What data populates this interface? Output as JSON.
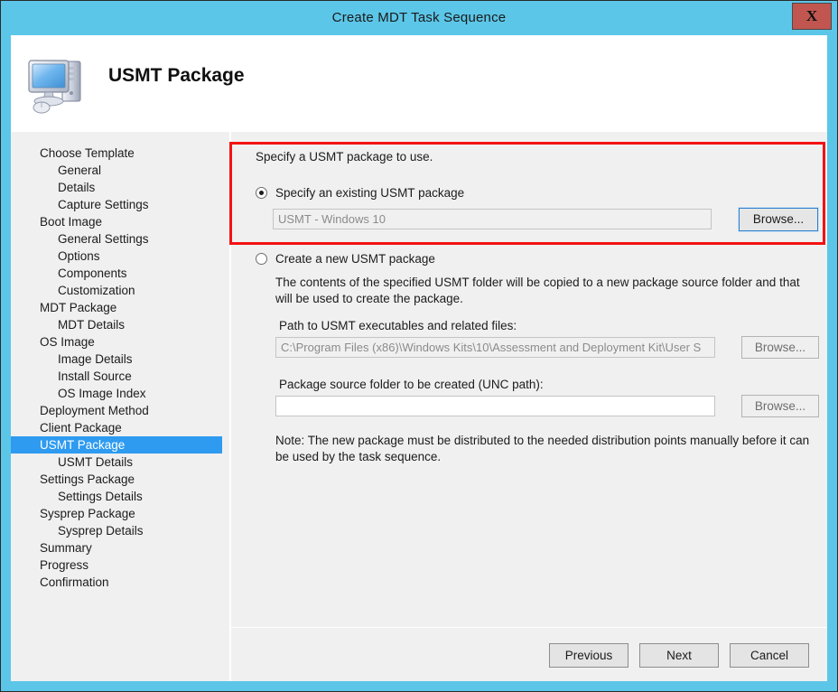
{
  "window": {
    "title": "Create MDT Task Sequence",
    "close_label": "X",
    "border_color": "#5cc6e8",
    "titlebar_color": "#5cc6e8",
    "close_button_color": "#c0564f"
  },
  "header": {
    "page_title": "USMT Package",
    "icon": "computer-monitor-icon"
  },
  "sidebar": {
    "items": [
      {
        "label": "Choose Template",
        "level": 1,
        "selected": false
      },
      {
        "label": "General",
        "level": 2,
        "selected": false
      },
      {
        "label": "Details",
        "level": 2,
        "selected": false
      },
      {
        "label": "Capture Settings",
        "level": 2,
        "selected": false
      },
      {
        "label": "Boot Image",
        "level": 1,
        "selected": false
      },
      {
        "label": "General Settings",
        "level": 2,
        "selected": false
      },
      {
        "label": "Options",
        "level": 2,
        "selected": false
      },
      {
        "label": "Components",
        "level": 2,
        "selected": false
      },
      {
        "label": "Customization",
        "level": 2,
        "selected": false
      },
      {
        "label": "MDT Package",
        "level": 1,
        "selected": false
      },
      {
        "label": "MDT Details",
        "level": 2,
        "selected": false
      },
      {
        "label": "OS Image",
        "level": 1,
        "selected": false
      },
      {
        "label": "Image Details",
        "level": 2,
        "selected": false
      },
      {
        "label": "Install Source",
        "level": 2,
        "selected": false
      },
      {
        "label": "OS Image Index",
        "level": 2,
        "selected": false
      },
      {
        "label": "Deployment Method",
        "level": 1,
        "selected": false
      },
      {
        "label": "Client Package",
        "level": 1,
        "selected": false
      },
      {
        "label": "USMT Package",
        "level": 1,
        "selected": true
      },
      {
        "label": "USMT Details",
        "level": 2,
        "selected": false
      },
      {
        "label": "Settings Package",
        "level": 1,
        "selected": false
      },
      {
        "label": "Settings Details",
        "level": 2,
        "selected": false
      },
      {
        "label": "Sysprep Package",
        "level": 1,
        "selected": false
      },
      {
        "label": "Sysprep Details",
        "level": 2,
        "selected": false
      },
      {
        "label": "Summary",
        "level": 1,
        "selected": false
      },
      {
        "label": "Progress",
        "level": 1,
        "selected": false
      },
      {
        "label": "Confirmation",
        "level": 1,
        "selected": false
      }
    ],
    "selected_color": "#2e9bf0"
  },
  "content": {
    "intro": "Specify a USMT package to use.",
    "option_existing": {
      "label": "Specify an existing USMT package",
      "selected": true,
      "package_value": "USMT - Windows 10",
      "browse_label": "Browse..."
    },
    "option_new": {
      "label": "Create a new USMT package",
      "selected": false,
      "description": "The contents of the specified USMT folder will be copied to a new package source folder and that will be used to create the package.",
      "path_label": "Path to USMT executables and related files:",
      "path_value": "C:\\Program Files (x86)\\Windows Kits\\10\\Assessment and Deployment Kit\\User S",
      "path_browse_label": "Browse...",
      "source_label": "Package source folder to be created (UNC path):",
      "source_value": "",
      "source_browse_label": "Browse...",
      "note": "Note: The new package must be distributed to the needed distribution points manually before it can be used by the task sequence."
    },
    "highlight_color": "#f41212"
  },
  "footer": {
    "previous_label": "Previous",
    "next_label": "Next",
    "cancel_label": "Cancel"
  }
}
